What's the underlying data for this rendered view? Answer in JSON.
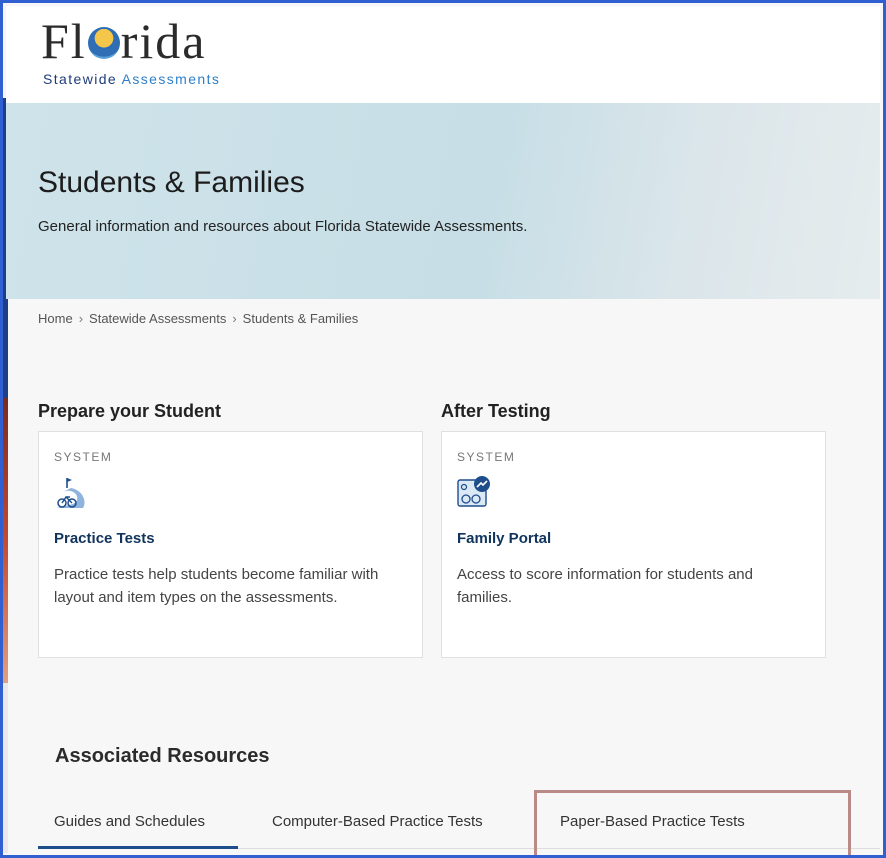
{
  "header": {
    "logo_pre": "Fl",
    "logo_post": "rida",
    "logo_sub_1": "Statewide",
    "logo_sub_2": "Assessments"
  },
  "hero": {
    "title": "Students & Families",
    "subtitle": "General information and resources about Florida Statewide Assessments."
  },
  "breadcrumb": [
    "Home",
    "Statewide Assessments",
    "Students & Families"
  ],
  "sections": [
    {
      "heading": "Prepare your Student",
      "card": {
        "kicker": "SYSTEM",
        "icon": "bike-path-icon",
        "title": "Practice Tests",
        "text": "Practice tests help students become familiar with layout and item types on the assessments."
      }
    },
    {
      "heading": "After Testing",
      "card": {
        "kicker": "SYSTEM",
        "icon": "family-portal-icon",
        "title": "Family Portal",
        "text": "Access to score information for students and families."
      }
    }
  ],
  "associated": {
    "heading": "Associated Resources",
    "tabs": [
      "Guides and Schedules",
      "Computer-Based Practice Tests",
      "Paper-Based Practice Tests"
    ],
    "active_tab": "Guides and Schedules"
  },
  "colors": {
    "frame": "#2f5fd0",
    "title_blue": "#10345c",
    "tab_active": "#1e4d8c",
    "highlight": "#b98a86"
  }
}
